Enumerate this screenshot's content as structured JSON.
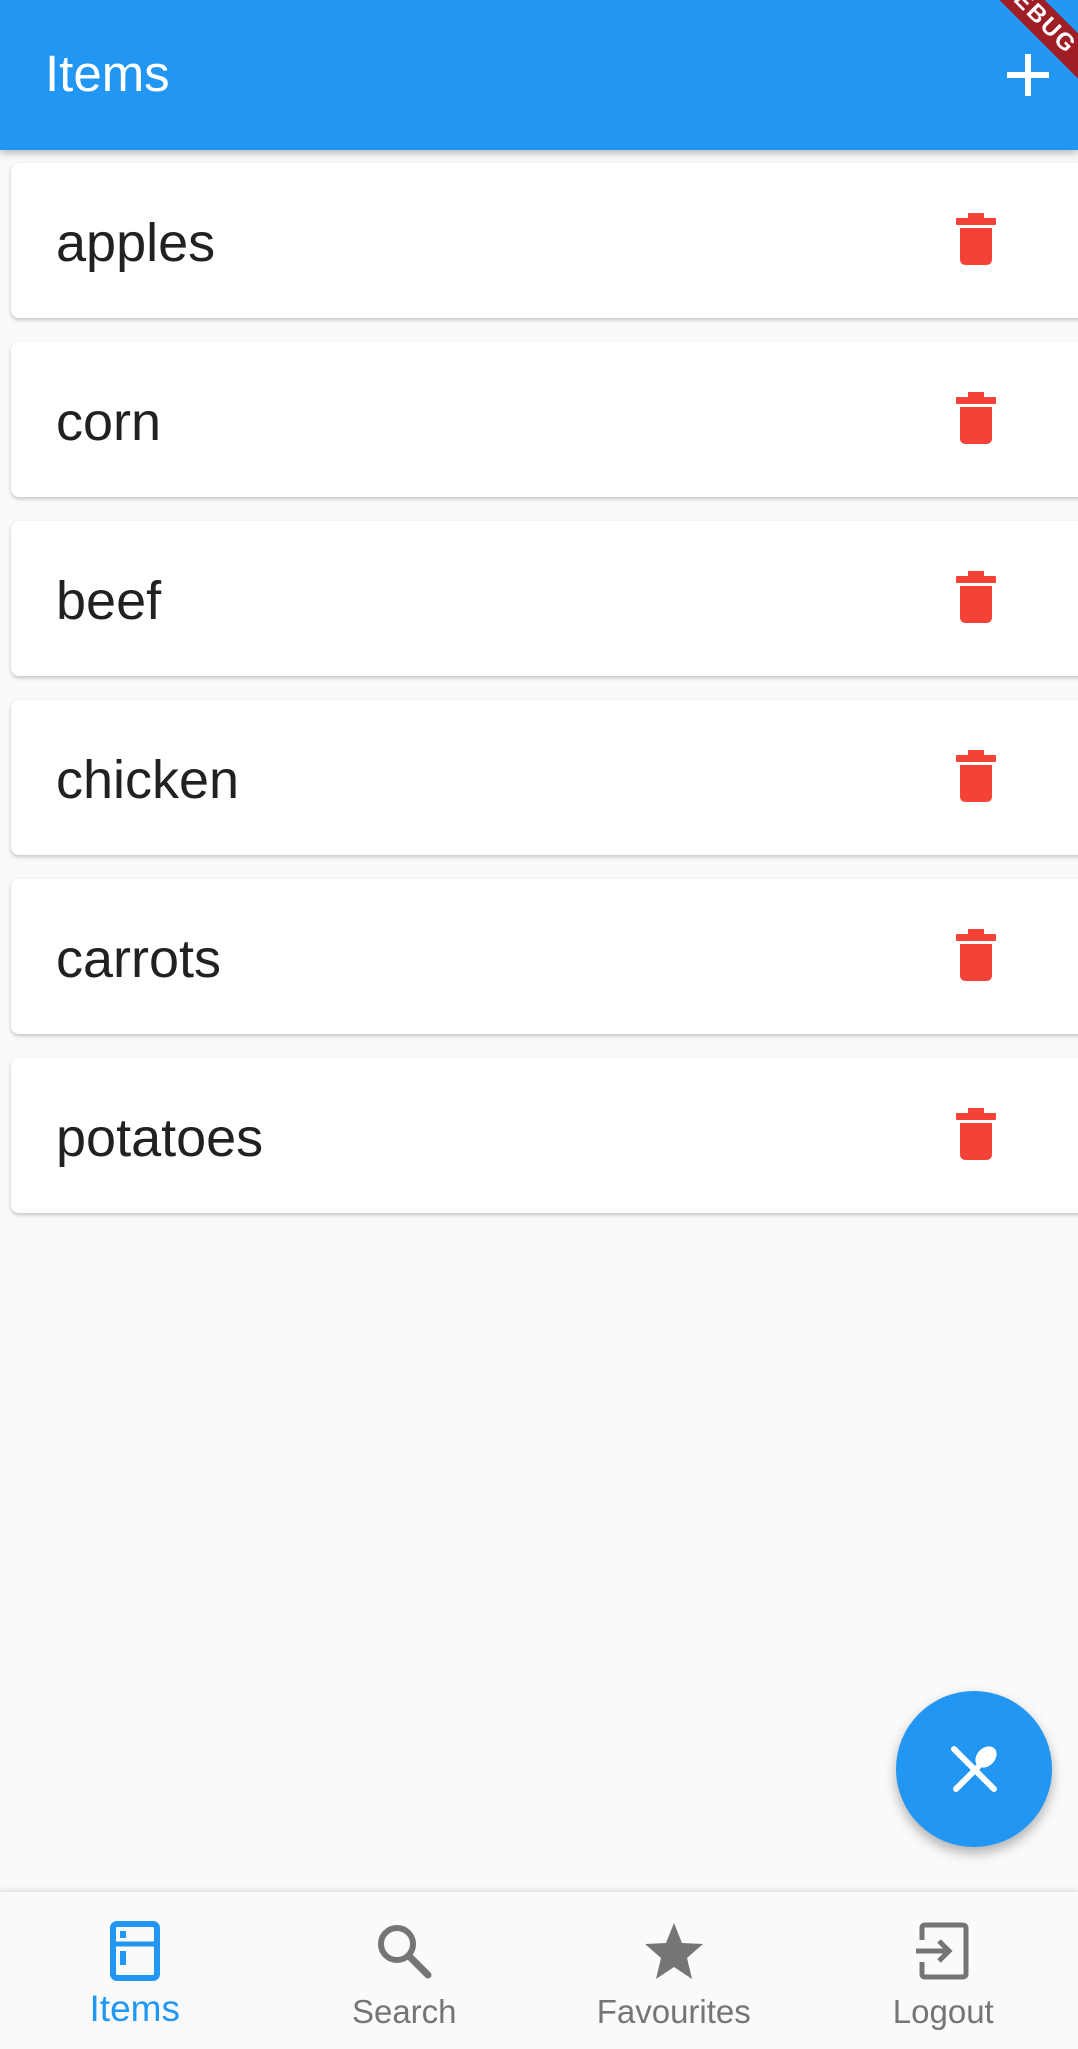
{
  "app_bar": {
    "title": "Items",
    "add_icon": "plus-icon",
    "debug_banner": "DEBUG"
  },
  "items": [
    {
      "label": "apples",
      "icon": "trash-icon"
    },
    {
      "label": "corn",
      "icon": "trash-icon"
    },
    {
      "label": "beef",
      "icon": "trash-icon"
    },
    {
      "label": "chicken",
      "icon": "trash-icon"
    },
    {
      "label": "carrots",
      "icon": "trash-icon"
    },
    {
      "label": "potatoes",
      "icon": "trash-icon"
    }
  ],
  "fab": {
    "icon": "utensils-icon"
  },
  "bottom_nav": {
    "items": [
      {
        "label": "Items",
        "icon": "fridge-icon",
        "active": true
      },
      {
        "label": "Search",
        "icon": "search-icon",
        "active": false
      },
      {
        "label": "Favourites",
        "icon": "star-icon",
        "active": false
      },
      {
        "label": "Logout",
        "icon": "logout-icon",
        "active": false
      }
    ]
  },
  "colors": {
    "primary": "#2196f3",
    "delete": "#f44336",
    "inactive": "#757575",
    "background": "#fafafa"
  }
}
